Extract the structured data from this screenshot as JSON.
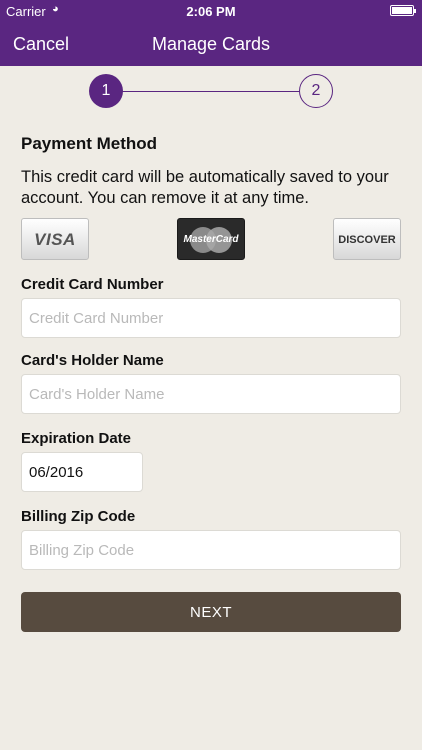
{
  "status_bar": {
    "carrier": "Carrier",
    "time": "2:06 PM"
  },
  "nav": {
    "cancel_label": "Cancel",
    "title": "Manage Cards"
  },
  "stepper": {
    "step1": "1",
    "step2": "2",
    "current": 1
  },
  "payment": {
    "title": "Payment Method",
    "description": "This credit card will be automatically saved to your account. You can remove it at any time."
  },
  "cards": {
    "visa": "VISA",
    "mastercard": "MasterCard",
    "discover": "DISCOVER"
  },
  "form": {
    "card_number_label": "Credit Card Number",
    "card_number_placeholder": "Credit Card Number",
    "card_number_value": "",
    "holder_label": "Card's Holder Name",
    "holder_placeholder": "Card's Holder Name",
    "holder_value": "",
    "expiration_label": "Expiration Date",
    "expiration_value": "06/2016",
    "zip_label": "Billing Zip Code",
    "zip_placeholder": "Billing Zip Code",
    "zip_value": ""
  },
  "next_label": "NEXT",
  "colors": {
    "accent": "#5a2681",
    "button": "#574b3f",
    "background": "#efece5"
  }
}
